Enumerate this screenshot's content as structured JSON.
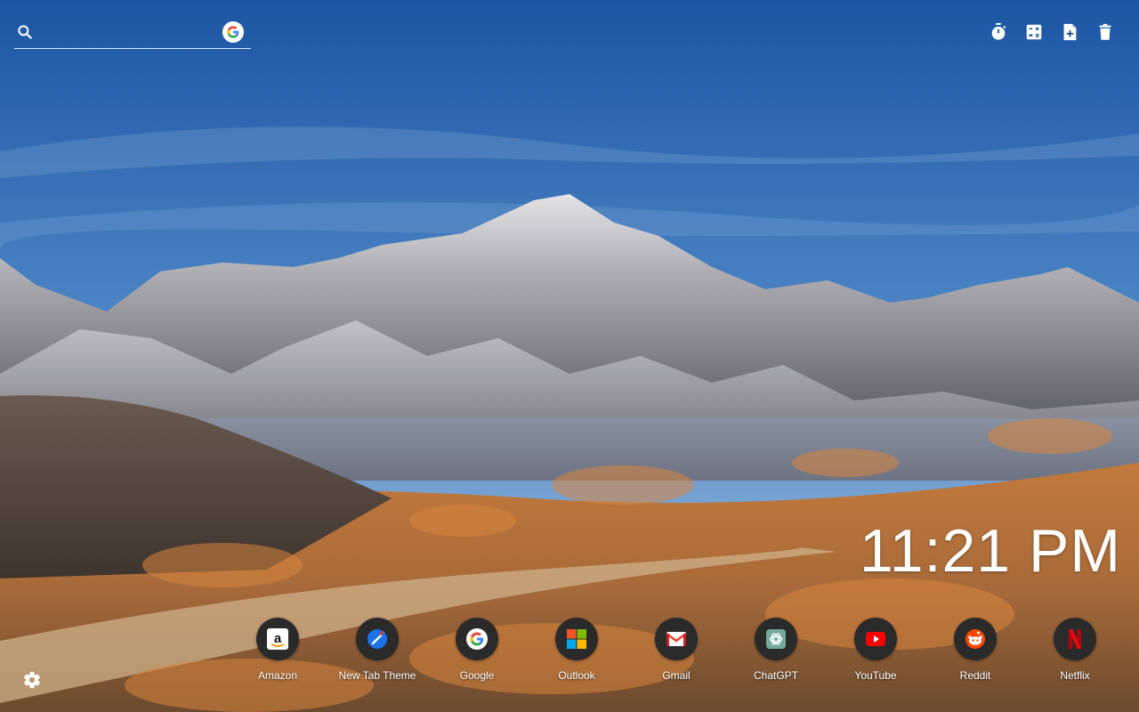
{
  "search": {
    "placeholder": "",
    "value": "",
    "engine_icon": "google-g-icon"
  },
  "toolbar": {
    "icons": [
      "stopwatch-icon",
      "calculator-icon",
      "add-note-icon",
      "trash-icon"
    ]
  },
  "clock": {
    "time": "11:21 PM"
  },
  "shortcuts": [
    {
      "label": "Amazon",
      "icon": "amazon-icon"
    },
    {
      "label": "New Tab Theme",
      "icon": "new-tab-theme-icon"
    },
    {
      "label": "Google",
      "icon": "google-icon"
    },
    {
      "label": "Outlook",
      "icon": "microsoft-icon"
    },
    {
      "label": "Gmail",
      "icon": "gmail-icon"
    },
    {
      "label": "ChatGPT",
      "icon": "chatgpt-icon"
    },
    {
      "label": "YouTube",
      "icon": "youtube-icon"
    },
    {
      "label": "Reddit",
      "icon": "reddit-icon"
    },
    {
      "label": "Netflix",
      "icon": "netflix-icon"
    }
  ],
  "settings": {
    "icon": "gear-icon"
  },
  "colors": {
    "sky_top": "#1f5aa8",
    "sky_bottom": "#8fb3d9",
    "mountain": "#8d8c92",
    "brush": "#c87a38",
    "shortcut_bg": "#2a2a2a"
  }
}
